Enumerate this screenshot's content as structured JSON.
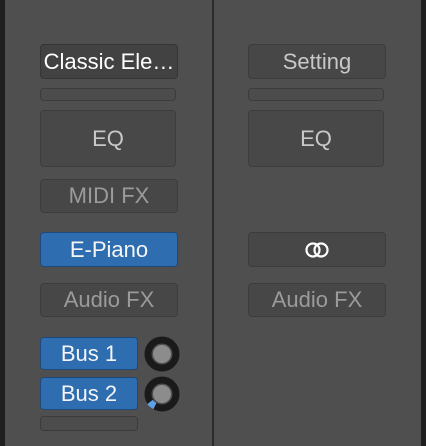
{
  "left_strip": {
    "instrument_setting": "Classic Ele…",
    "eq_label": "EQ",
    "midi_fx_label": "MIDI FX",
    "instrument_plugin": "E-Piano",
    "audio_fx_label": "Audio FX",
    "sends": [
      {
        "label": "Bus 1",
        "level": 0.0
      },
      {
        "label": "Bus 2",
        "level": 0.12
      }
    ]
  },
  "right_strip": {
    "setting_label": "Setting",
    "eq_label": "EQ",
    "input_icon": "stereo-link-icon",
    "audio_fx_label": "Audio FX"
  },
  "colors": {
    "send_blue": "#2f6db1",
    "knob_value": "#5ea0e6"
  }
}
